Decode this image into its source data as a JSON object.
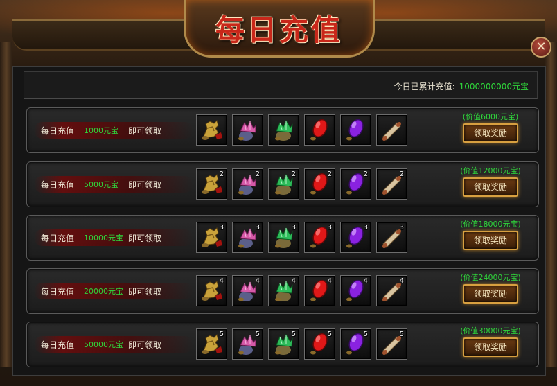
{
  "window": {
    "title": "每日充值",
    "close_label": "✕"
  },
  "summary": {
    "label": "今日已累计充值:",
    "value": "1000000000元宝"
  },
  "colors": {
    "accent_green": "#2fd63b",
    "title_red": "#c8271a",
    "button_gold": "#d8a040"
  },
  "item_icons": [
    "golden-dragon-icon",
    "pink-gem-pouch-icon",
    "green-gem-pouch-icon",
    "red-gem-icon",
    "purple-gem-icon",
    "scroll-icon"
  ],
  "tiers": [
    {
      "prefix": "每日充值",
      "amount": "1000元宝",
      "suffix": "即可领取",
      "counts": [
        "",
        "",
        "",
        "",
        "",
        ""
      ],
      "value": "(价值6000元宝)",
      "button": "领取奖励"
    },
    {
      "prefix": "每日充值",
      "amount": "5000元宝",
      "suffix": "即可领取",
      "counts": [
        "2",
        "2",
        "2",
        "2",
        "2",
        "2"
      ],
      "value": "(价值12000元宝)",
      "button": "领取奖励"
    },
    {
      "prefix": "每日充值",
      "amount": "10000元宝",
      "suffix": "即可领取",
      "counts": [
        "3",
        "3",
        "3",
        "3",
        "3",
        "3"
      ],
      "value": "(价值18000元宝)",
      "button": "领取奖励"
    },
    {
      "prefix": "每日充值",
      "amount": "20000元宝",
      "suffix": "即可领取",
      "counts": [
        "4",
        "4",
        "4",
        "4",
        "4",
        "4"
      ],
      "value": "(价值24000元宝)",
      "button": "领取奖励"
    },
    {
      "prefix": "每日充值",
      "amount": "50000元宝",
      "suffix": "即可领取",
      "counts": [
        "5",
        "5",
        "5",
        "5",
        "5",
        "5"
      ],
      "value": "(价值30000元宝)",
      "button": "领取奖励"
    }
  ]
}
